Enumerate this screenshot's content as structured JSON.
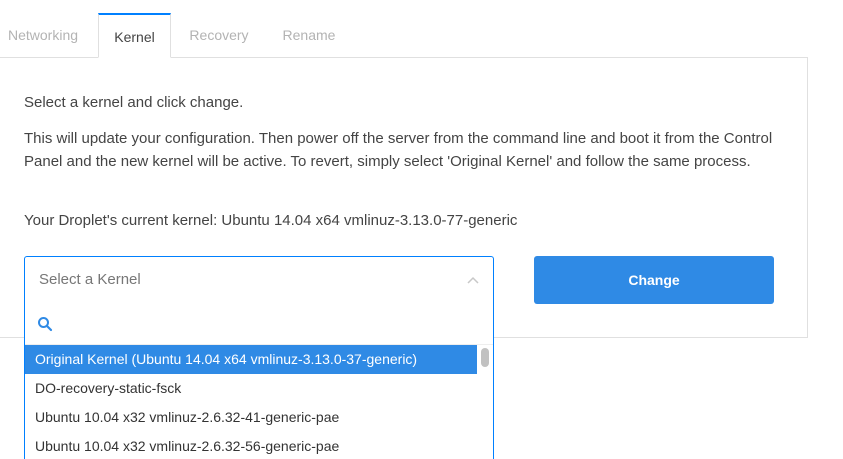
{
  "tabs": [
    {
      "label": "Networking",
      "active": false
    },
    {
      "label": "Kernel",
      "active": true
    },
    {
      "label": "Recovery",
      "active": false
    },
    {
      "label": "Rename",
      "active": false
    }
  ],
  "panel": {
    "intro": "Select a kernel and click change.",
    "description": "This will update your configuration. Then power off the server from the command line and boot it from the Control Panel and the new kernel will be active. To revert, simply select 'Original Kernel' and follow the same process.",
    "current_kernel": "Your Droplet's current kernel: Ubuntu 14.04 x64 vmlinuz-3.13.0-77-generic"
  },
  "kernel_select": {
    "placeholder": "Select a Kernel",
    "search_value": "",
    "options": [
      "Original Kernel (Ubuntu 14.04 x64 vmlinuz-3.13.0-37-generic)",
      "DO-recovery-static-fsck",
      "Ubuntu 10.04 x32 vmlinuz-2.6.32-41-generic-pae",
      "Ubuntu 10.04 x32 vmlinuz-2.6.32-56-generic-pae"
    ],
    "highlighted_index": 0
  },
  "change_button": {
    "label": "Change"
  },
  "colors": {
    "accent": "#0080ff",
    "button": "#2f8ae5",
    "highlight": "#2f8ae5",
    "text": "#444444",
    "muted": "#b3b3b3"
  }
}
